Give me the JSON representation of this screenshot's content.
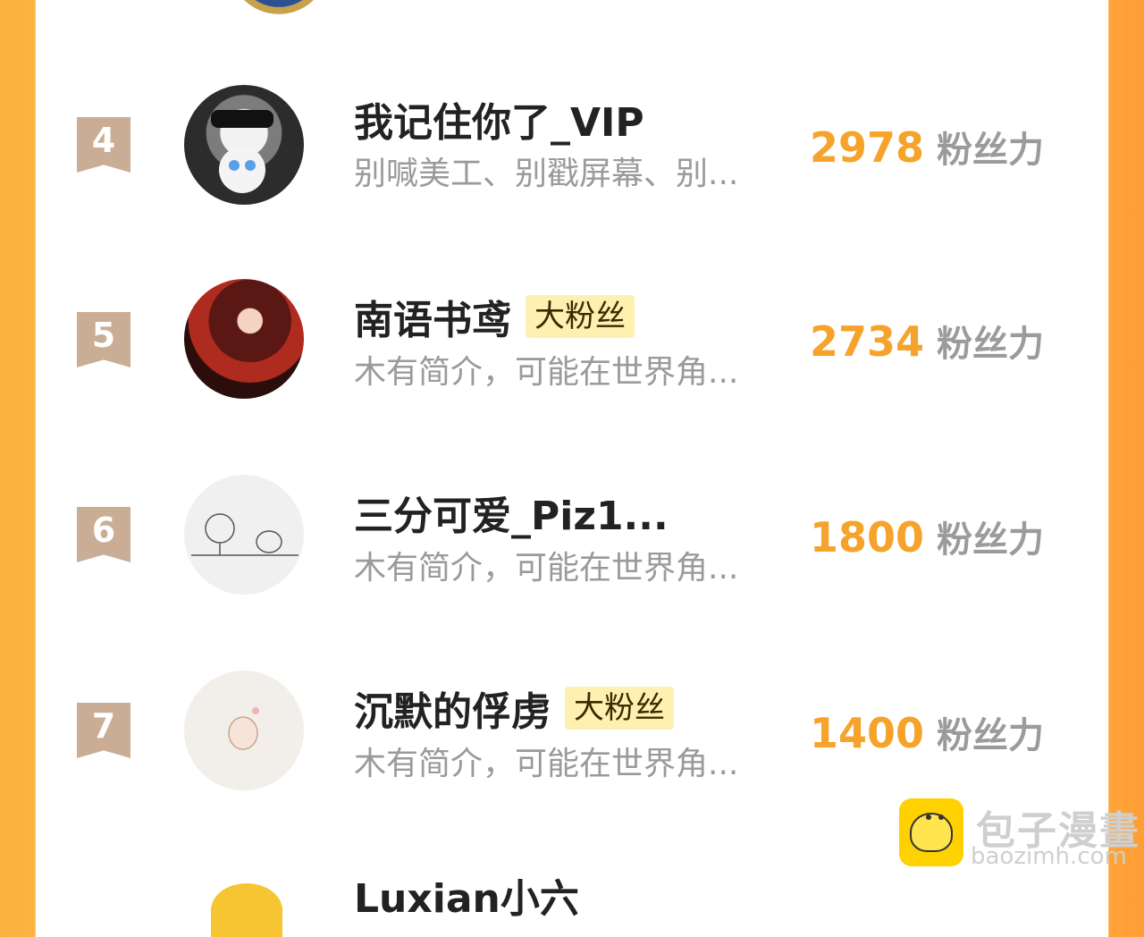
{
  "rows": [
    {
      "rank": "4",
      "name": "我记住你了_VIP",
      "tag": "",
      "bio": "别喊美工、别戳屏幕、别...",
      "score": "2978",
      "unit": "粉丝力"
    },
    {
      "rank": "5",
      "name": "南语书鸢",
      "tag": "大粉丝",
      "bio": "木有简介，可能在世界角...",
      "score": "2734",
      "unit": "粉丝力"
    },
    {
      "rank": "6",
      "name": "三分可爱_Piz1...",
      "tag": "",
      "bio": "木有简介，可能在世界角...",
      "score": "1800",
      "unit": "粉丝力"
    },
    {
      "rank": "7",
      "name": "沉默的俘虏",
      "tag": "大粉丝",
      "bio": "木有简介，可能在世界角...",
      "score": "1400",
      "unit": "粉丝力"
    }
  ],
  "bottom_partial_name": "Luxian小六",
  "watermark": {
    "title": "包子漫畫",
    "url": "baozimh.com"
  },
  "colors": {
    "accent": "#f5a32b",
    "rank_badge": "#c9ad95",
    "tag_bg": "#fdf0b0"
  }
}
